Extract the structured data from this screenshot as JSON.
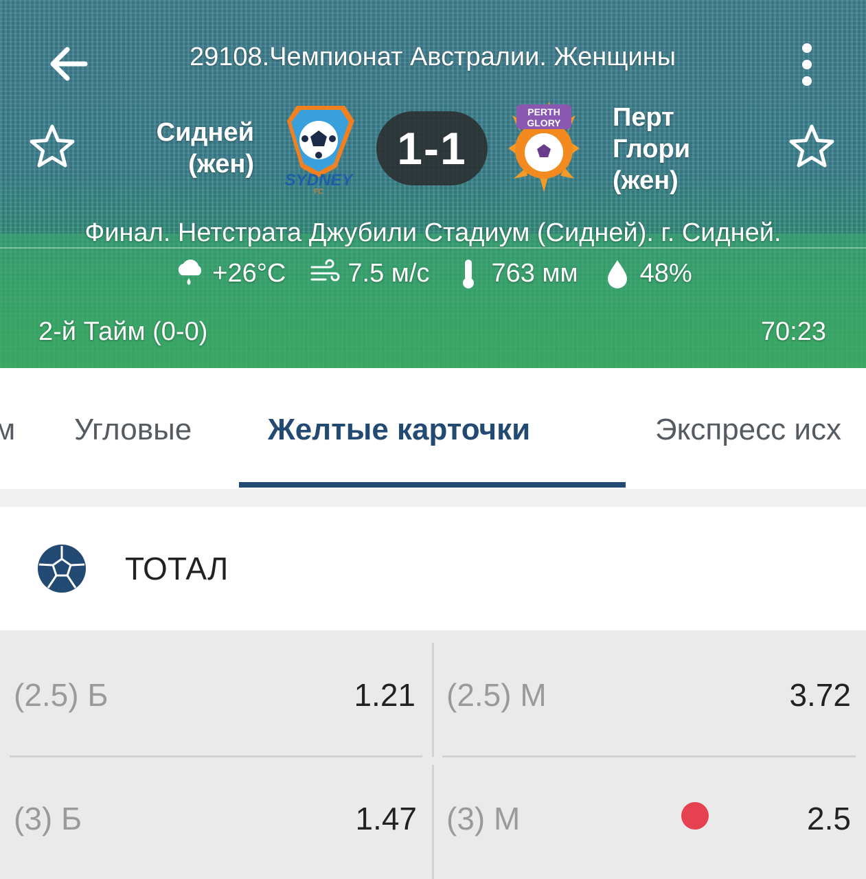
{
  "header": {
    "league_title": "29108.Чемпионат Австралии. Женщины",
    "home_team": {
      "name_line1": "Сидней",
      "name_line2": "(жен)",
      "logo_text": "SYDNEY",
      "logo_sub": "FC"
    },
    "away_team": {
      "name_line1": "Перт",
      "name_line2": "Глори",
      "name_line3": "(жен)",
      "logo_text_1": "PERTH",
      "logo_text_2": "GLORY"
    },
    "score": "1-1",
    "venue": "Финал. Нетстрата Джубили Стадиум (Сидней). г. Сидней.",
    "weather": {
      "temperature": "+26°C",
      "wind": "7.5 м/с",
      "pressure": "763 мм",
      "humidity": "48%"
    },
    "period": "2-й  Тайм (0-0)",
    "match_time": "70:23"
  },
  "tabs": {
    "partial": "м",
    "corners": "Угловые",
    "yellow_cards": "Желтые карточки",
    "express": "Экспресс исх"
  },
  "market": {
    "title": "ТОТАЛ",
    "rows": [
      {
        "left_label": "(2.5) Б",
        "left_value": "1.21",
        "right_label": "(2.5) М",
        "right_value": "3.72"
      },
      {
        "left_label": "(3) Б",
        "left_value": "1.47",
        "right_label": "(3) М",
        "right_value": "2.5"
      }
    ]
  },
  "colors": {
    "accent": "#224a72",
    "live_dot": "#e64150"
  }
}
